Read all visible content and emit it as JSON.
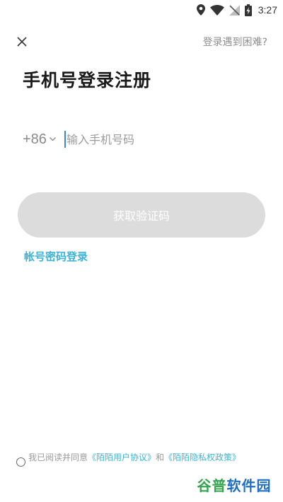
{
  "status_bar": {
    "time": "3:27",
    "icons": [
      "location-icon",
      "wifi-icon",
      "no-signal-icon",
      "battery-charging-icon"
    ]
  },
  "header": {
    "close_icon": "close-icon",
    "help_label": "登录遇到困难?"
  },
  "title": "手机号登录注册",
  "phone": {
    "country_code": "+86",
    "placeholder": "输入手机号码",
    "value": ""
  },
  "get_code_button": "获取验证码",
  "password_login_link": "帐号密码登录",
  "agreement": {
    "prefix": "我已阅读并同意",
    "user_agreement": "《陌陌用户协议》",
    "and": "和",
    "privacy_policy": "《陌陌隐私权政策》",
    "checked": false
  },
  "watermark": {
    "part1": "谷普",
    "part2": "软件园"
  },
  "colors": {
    "accent": "#3cb4d6",
    "button_disabled": "#dcdcdc",
    "caret": "#3a87d6"
  }
}
